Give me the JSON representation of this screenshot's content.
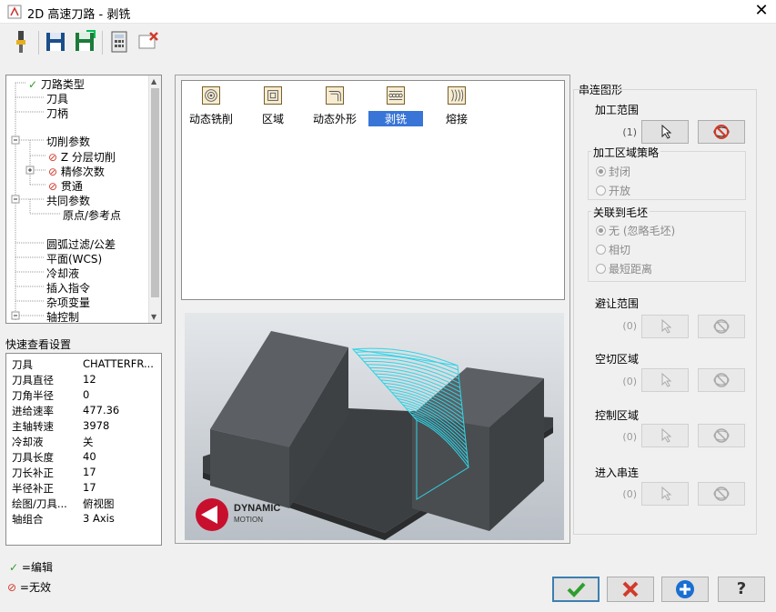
{
  "window": {
    "title": "2D 高速刀路 - 剥铣",
    "close_glyph": "✕"
  },
  "tree": {
    "items": [
      {
        "label": "刀路类型",
        "mark": "check"
      },
      {
        "label": "刀具",
        "mark": ""
      },
      {
        "label": "刀柄",
        "mark": ""
      },
      {
        "label": "切削参数",
        "mark": ""
      },
      {
        "label": "Z 分层切削",
        "mark": "invalid"
      },
      {
        "label": "精修次数",
        "mark": "invalid"
      },
      {
        "label": "贯通",
        "mark": "invalid"
      },
      {
        "label": "共同参数",
        "mark": ""
      },
      {
        "label": "原点/参考点",
        "mark": ""
      },
      {
        "label": "圆弧过滤/公差",
        "mark": ""
      },
      {
        "label": "平面(WCS)",
        "mark": ""
      },
      {
        "label": "冷却液",
        "mark": ""
      },
      {
        "label": "插入指令",
        "mark": ""
      },
      {
        "label": "杂项变量",
        "mark": ""
      },
      {
        "label": "轴控制",
        "mark": ""
      }
    ]
  },
  "quick_settings": {
    "title": "快速查看设置",
    "rows": [
      {
        "k": "刀具",
        "v": "CHATTERFR..."
      },
      {
        "k": "刀具直径",
        "v": "12"
      },
      {
        "k": "刀角半径",
        "v": "0"
      },
      {
        "k": "进给速率",
        "v": "477.36"
      },
      {
        "k": "主轴转速",
        "v": "3978"
      },
      {
        "k": "冷却液",
        "v": "关"
      },
      {
        "k": "刀具长度",
        "v": "40"
      },
      {
        "k": "刀长补正",
        "v": "17"
      },
      {
        "k": "半径补正",
        "v": "17"
      },
      {
        "k": "绘图/刀具...",
        "v": "俯视图"
      },
      {
        "k": "轴组合",
        "v": "3 Axis"
      }
    ]
  },
  "legend": {
    "edit": "=编辑",
    "invalid": "=无效"
  },
  "operations": [
    {
      "label": "动态铣削"
    },
    {
      "label": "区域"
    },
    {
      "label": "动态外形"
    },
    {
      "label": "剥铣",
      "selected": true
    },
    {
      "label": "熔接"
    }
  ],
  "preview": {
    "logo_line1": "DYNAMIC",
    "logo_line2": "MOTION"
  },
  "chain": {
    "title": "串连图形",
    "machining_range": {
      "label": "加工范围",
      "count": "(1)"
    },
    "strategy": {
      "title": "加工区域策略",
      "options": [
        "封闭",
        "开放"
      ],
      "selected": 0
    },
    "stock": {
      "title": "关联到毛坯",
      "options": [
        "无 (忽略毛坯)",
        "相切",
        "最短距离"
      ],
      "selected": 0
    },
    "sections": [
      {
        "label": "避让范围",
        "count": "(0)"
      },
      {
        "label": "空切区域",
        "count": "(0)"
      },
      {
        "label": "控制区域",
        "count": "(0)"
      },
      {
        "label": "进入串连",
        "count": "(0)"
      }
    ]
  },
  "buttons": {
    "help": "?"
  },
  "colors": {
    "accent": "#3875d7",
    "check": "#2e9e2e",
    "invalid": "#d23a2a",
    "toolpath": "#2fd4e6"
  }
}
